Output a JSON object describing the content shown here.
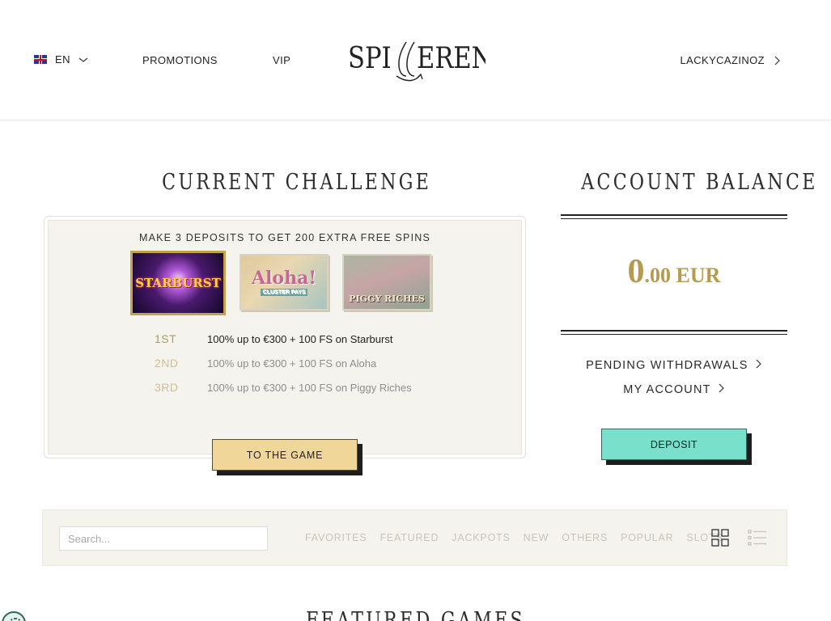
{
  "header": {
    "language": "EN",
    "nav": [
      "PROMOTIONS",
      "VIP"
    ],
    "logo_text": "SPILLEREN",
    "username": "LACKYCAZINOZ"
  },
  "challenge": {
    "title": "CURRENT CHALLENGE",
    "headline": "MAKE 3 DEPOSITS TO GET 200 EXTRA FREE SPINS",
    "games": [
      "STARBURST",
      "Aloha!",
      "PIGGY RICHES"
    ],
    "aloha_sub": "CLUSTER PAYS",
    "steps": [
      {
        "rank": "1ST",
        "text": "100% up to €300 + 100 FS on Starburst"
      },
      {
        "rank": "2ND",
        "text": "100% up to €300 + 100 FS on Aloha"
      },
      {
        "rank": "3RD",
        "text": "100% up to €300 + 100 FS on Piggy Riches"
      }
    ],
    "button": "TO THE GAME"
  },
  "account": {
    "title": "ACCOUNT BALANCE",
    "balance_int": "0",
    "balance_dec": ".00 EUR",
    "links": [
      "PENDING WITHDRAWALS",
      "MY ACCOUNT"
    ],
    "deposit": "DEPOSIT"
  },
  "filter_bar": {
    "search_placeholder": "Search...",
    "filters": [
      "FAVORITES",
      "FEATURED",
      "JACKPOTS",
      "NEW",
      "OTHERS",
      "POPULAR",
      "SLOTS"
    ]
  },
  "featured_title": "FEATURED GAMES",
  "colors": {
    "gold": "#b59a4f",
    "deposit_teal": "#78e0cb",
    "game_button": "#f0d699",
    "card_bg": "#f4f3ee"
  }
}
